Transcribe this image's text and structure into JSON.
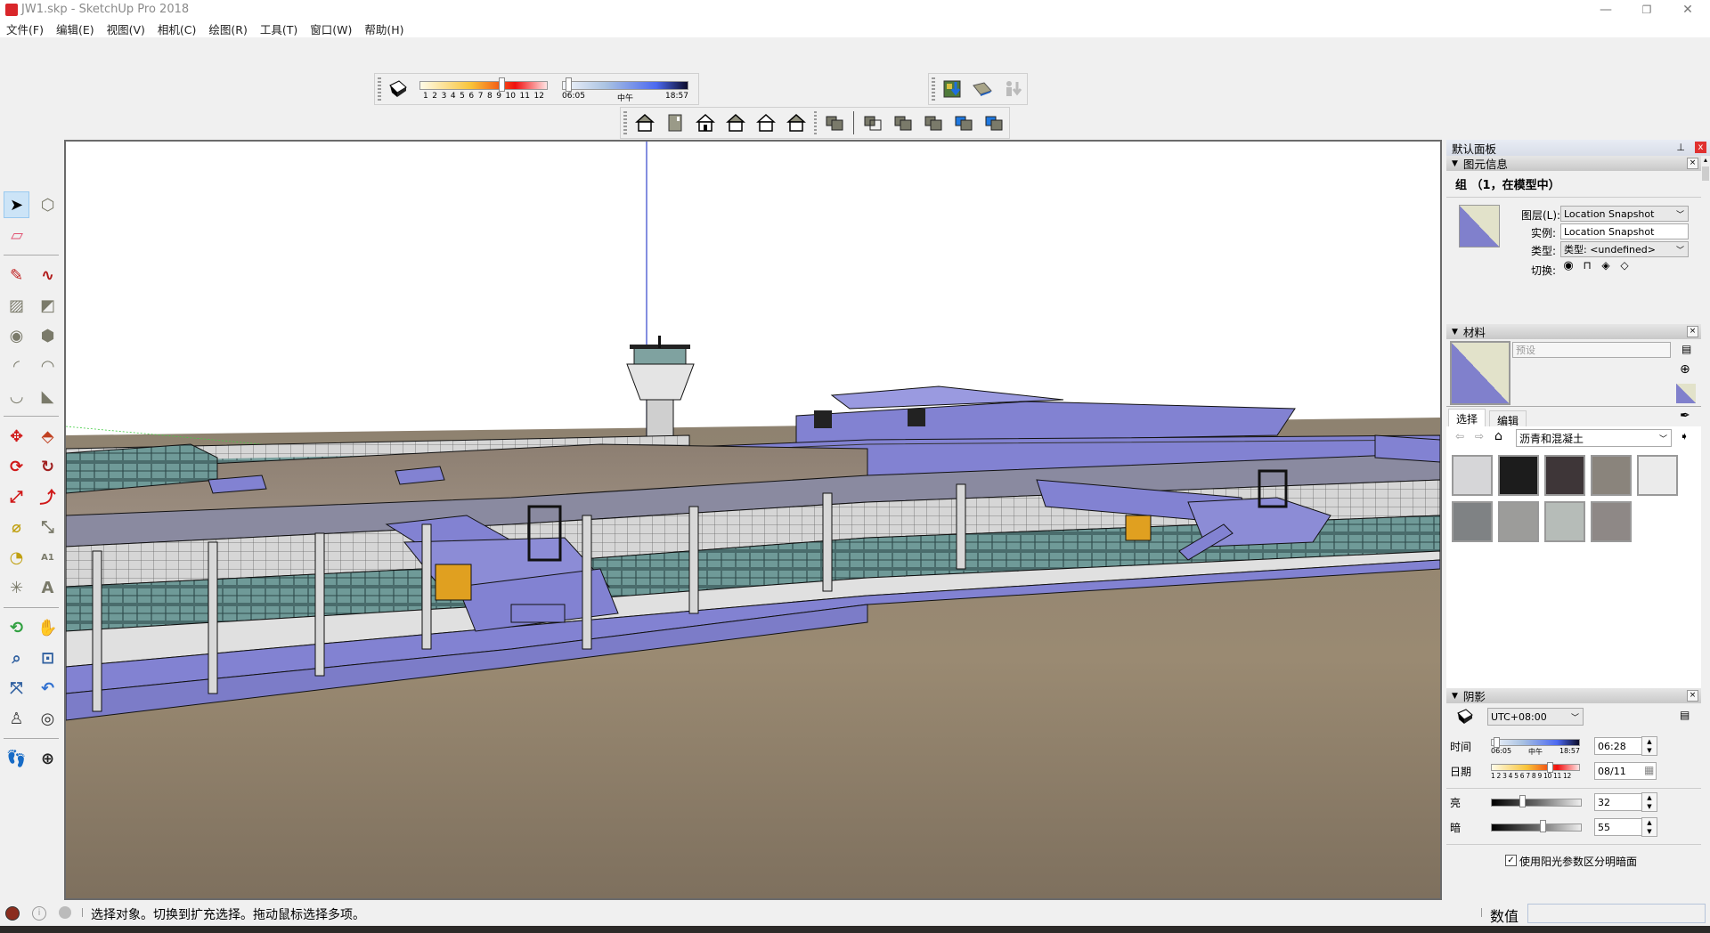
{
  "window": {
    "title": "JW1.skp - SketchUp Pro 2018",
    "controls": {
      "minimize": "—",
      "restore": "❐",
      "close": "✕"
    }
  },
  "menu": [
    {
      "label": "文件(F)"
    },
    {
      "label": "编辑(E)"
    },
    {
      "label": "视图(V)"
    },
    {
      "label": "相机(C)"
    },
    {
      "label": "绘图(R)"
    },
    {
      "label": "工具(T)"
    },
    {
      "label": "窗口(W)"
    },
    {
      "label": "帮助(H)"
    }
  ],
  "shadow_toolbar": {
    "month_ticks": [
      "1",
      "2",
      "3",
      "4",
      "5",
      "6",
      "7",
      "8",
      "9",
      "10",
      "11",
      "12"
    ],
    "month_value": 8,
    "time_start": "06:05",
    "time_mid": "中午",
    "time_end": "18:57",
    "time_value_fraction": 0.03
  },
  "views_toolbar": {
    "icons": [
      "iso-view-icon",
      "top-view-icon",
      "front-view-icon",
      "right-view-icon",
      "back-view-icon",
      "left-view-icon"
    ]
  },
  "styles_toolbar": {
    "icons": [
      "xray-icon",
      "wireframe-icon",
      "hidden-line-icon",
      "shaded-icon",
      "shaded-textures-icon",
      "monochrome-icon"
    ]
  },
  "location_toolbar": {
    "icons": [
      "add-location-icon",
      "toggle-terrain-icon",
      "photo-textures-icon"
    ]
  },
  "tools": [
    [
      "select",
      "make-component"
    ],
    [
      "eraser"
    ],
    [
      "pencil",
      "freehand"
    ],
    [
      "rectangle",
      "rotated-rectangle"
    ],
    [
      "circle",
      "polygon"
    ],
    [
      "arc",
      "2pt-arc"
    ],
    [
      "3pt-arc",
      "pie"
    ],
    [
      "move",
      "push-pull"
    ],
    [
      "rotate",
      "follow-me"
    ],
    [
      "scale",
      "offset"
    ],
    [
      "tape-measure",
      "dimension"
    ],
    [
      "protractor",
      "text"
    ],
    [
      "axes",
      "3d-text"
    ],
    [
      "orbit",
      "pan"
    ],
    [
      "zoom",
      "zoom-window"
    ],
    [
      "zoom-extents",
      "previous"
    ],
    [
      "position-camera",
      "look-around"
    ],
    [
      "walk",
      "section-plane"
    ]
  ],
  "panel": {
    "title": "默认面板",
    "entity_info": {
      "header": "图元信息",
      "subject": "组 （1，在模型中）",
      "layer_label": "图层(L):",
      "layer_value": "Location Snapshot",
      "instance_label": "实例:",
      "instance_value": "Location Snapshot",
      "type_label": "类型:",
      "type_value": "类型: <undefined>",
      "toggle_label": "切换:"
    },
    "materials": {
      "header": "材料",
      "name_placeholder": "预设",
      "tab_select": "选择",
      "tab_edit": "编辑",
      "library": "沥青和混凝土",
      "swatches": [
        "#d6d6d8",
        "#1c1c1c",
        "#3e3638",
        "#8a847c",
        "#ebebeb",
        "#7f8284",
        "#9c9c9a",
        "#b6bcb8",
        "#8e8886"
      ]
    },
    "shadows": {
      "header": "阴影",
      "timezone": "UTC+08:00",
      "time_label": "时间",
      "time_start": "06:05",
      "time_mid": "中午",
      "time_end": "18:57",
      "time_value": "06:28",
      "date_label": "日期",
      "date_ticks": "1 2 3 4 5 6 7 8 9 10 11 12",
      "date_value": "08/11",
      "light_label": "亮",
      "light_value": "32",
      "dark_label": "暗",
      "dark_value": "55",
      "sun_checkbox_label": "使用阳光参数区分明暗面",
      "sun_checkbox_checked": true
    }
  },
  "status": {
    "message": "选择对象。切换到扩充选择。拖动鼠标选择多项。",
    "measurements_label": "数值",
    "measurements_value": ""
  },
  "colors": {
    "model_purple": "#8282d2",
    "ground": "#8c7c68",
    "selection_blue": "#cce4f7"
  }
}
